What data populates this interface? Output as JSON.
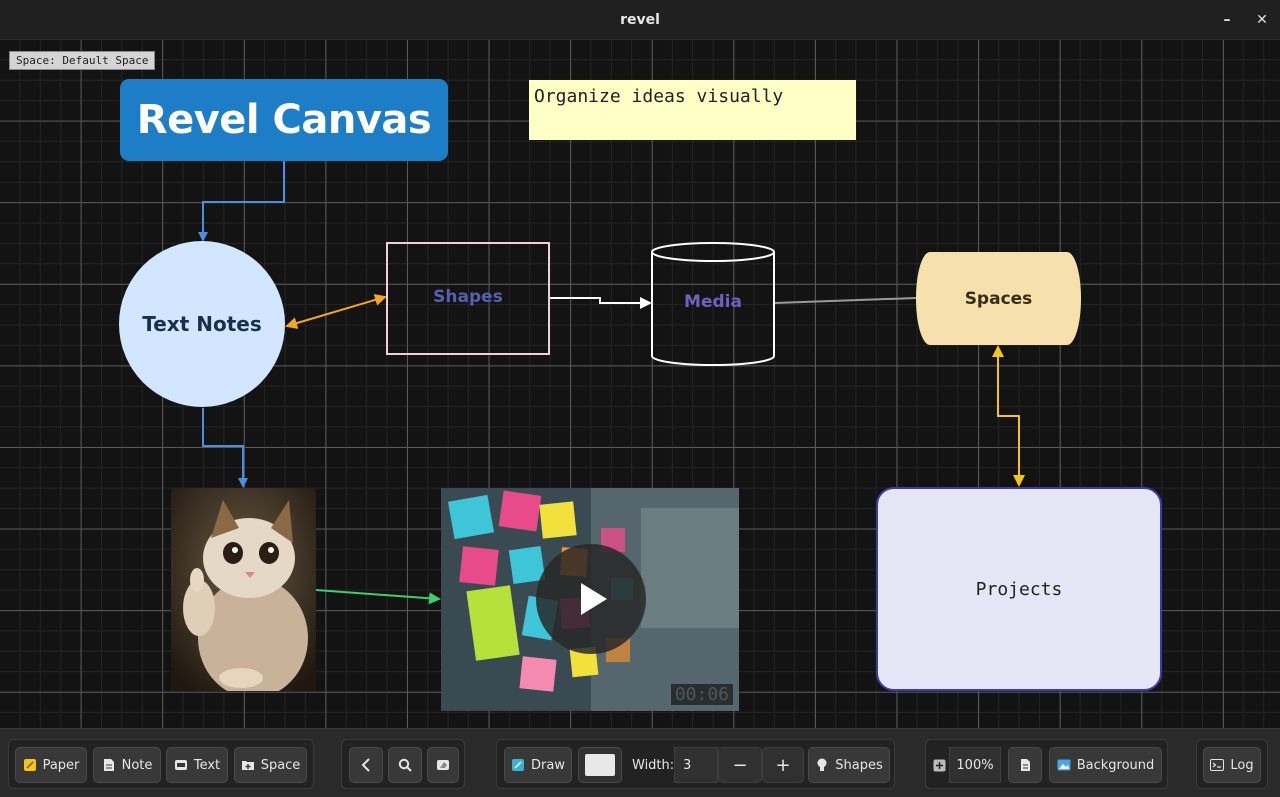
{
  "window": {
    "title": "revel",
    "minimize": "–",
    "close": "✕"
  },
  "canvas": {
    "space_label": "Space: Default Space",
    "title_block": "Revel Canvas",
    "sticky_note": "Organize ideas visually",
    "circle_note": "Text Notes",
    "rect_shape": "Shapes",
    "cylinder_shape": "Media",
    "spaces_shape": "Spaces",
    "projects_box": "Projects",
    "video_time": "00:06"
  },
  "toolbar": {
    "paper": "Paper",
    "note": "Note",
    "text": "Text",
    "space": "Space",
    "draw": "Draw",
    "width_label": "Width:",
    "width_value": "3",
    "minus": "−",
    "plus": "+",
    "shapes": "Shapes",
    "zoom": "100%",
    "background": "Background",
    "log": "Log"
  },
  "colors": {
    "accent_blue": "#1e7dc7",
    "arrow_orange": "#f5a623",
    "arrow_yellow": "#f5c518",
    "arrow_green": "#3ccf6e",
    "arrow_blue": "#4a8fe0"
  }
}
